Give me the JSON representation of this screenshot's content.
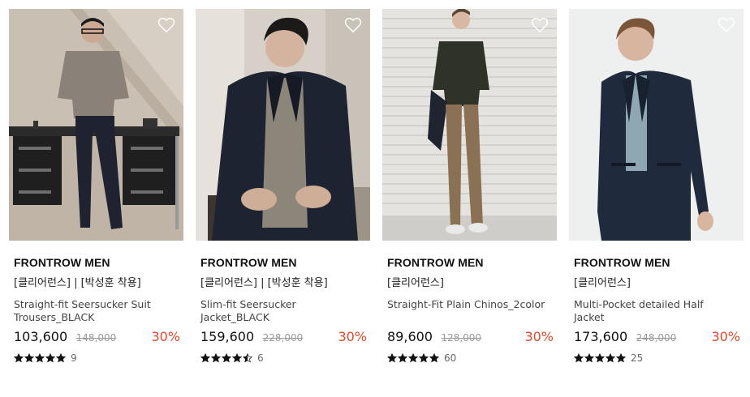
{
  "products": [
    {
      "brand": "FRONTROW MEN",
      "tag": "[클리어런스] | [박성훈 착용]",
      "name": "Straight-fit Seersucker Suit Trousers_BLACK",
      "price": "103,600",
      "original_price": "148,000",
      "discount": "30%",
      "rating": 5,
      "review_count": "9",
      "image_icon": "product-photo",
      "wishlist_icon": "heart-outline-icon"
    },
    {
      "brand": "FRONTROW MEN",
      "tag": "[클리어런스] | [박성훈 착용]",
      "name": "Slim-fit Seersucker Jacket_BLACK",
      "price": "159,600",
      "original_price": "228,000",
      "discount": "30%",
      "rating": 4.5,
      "review_count": "6",
      "image_icon": "product-photo",
      "wishlist_icon": "heart-outline-icon"
    },
    {
      "brand": "FRONTROW MEN",
      "tag": "[클리어런스]",
      "name": "Straight-Fit Plain Chinos_2color",
      "price": "89,600",
      "original_price": "128,000",
      "discount": "30%",
      "rating": 5,
      "review_count": "60",
      "image_icon": "product-photo",
      "wishlist_icon": "heart-outline-icon"
    },
    {
      "brand": "FRONTROW MEN",
      "tag": "[클리어런스]",
      "name": "Multi-Pocket detailed Half Jacket",
      "price": "173,600",
      "original_price": "248,000",
      "discount": "30%",
      "rating": 5,
      "review_count": "25",
      "image_icon": "product-photo",
      "wishlist_icon": "heart-outline-icon"
    }
  ],
  "colors": {
    "discount": "#e8472b",
    "star": "#111111",
    "original_price": "#999999"
  }
}
